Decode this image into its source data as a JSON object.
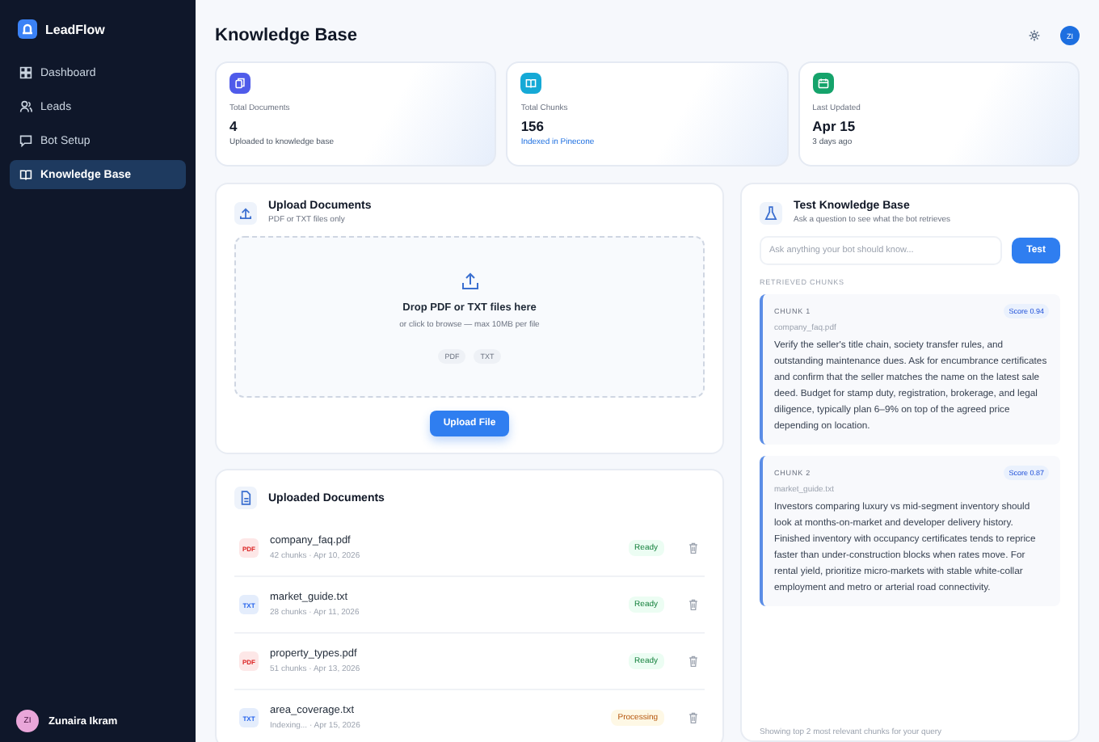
{
  "sidebar": {
    "brand": "LeadFlow",
    "items": [
      {
        "label": "Dashboard",
        "kind": "grid",
        "selected": false
      },
      {
        "label": "Leads",
        "kind": "users",
        "selected": false
      },
      {
        "label": "Bot Setup",
        "kind": "chat",
        "selected": false
      },
      {
        "label": "Knowledge Base",
        "kind": "book",
        "selected": true
      }
    ],
    "user": {
      "initials": "ZI",
      "name": "Zunaira Ikram"
    }
  },
  "header": {
    "title": "Knowledge Base",
    "avatar": "ZI"
  },
  "stats": [
    {
      "label": "Total Documents",
      "value": "4",
      "note": "Uploaded to knowledge base",
      "kind": "docs",
      "color": "#4f5bea",
      "highlight": false
    },
    {
      "label": "Total Chunks",
      "value": "156",
      "note": "Indexed in Pinecone",
      "kind": "book",
      "color": "#15a9d6",
      "highlight": true
    },
    {
      "label": "Last Updated",
      "value": "Apr 15",
      "note": "3 days ago",
      "kind": "calendar",
      "color": "#15a36b",
      "highlight": false
    }
  ],
  "upload": {
    "title": "Upload Documents",
    "subtitle": "PDF or TXT files only",
    "drop_title": "Drop PDF or TXT files here",
    "drop_hint": "or click to browse — max 10MB per file",
    "formats": [
      "PDF",
      "TXT"
    ],
    "button": "Upload File"
  },
  "documents": {
    "title": "Uploaded Documents",
    "items": [
      {
        "type": "PDF",
        "name": "company_faq.pdf",
        "meta": "42 chunks · Apr 10, 2026",
        "status": "Ready",
        "kind": "ready"
      },
      {
        "type": "TXT",
        "name": "market_guide.txt",
        "meta": "28 chunks · Apr 11, 2026",
        "status": "Ready",
        "kind": "ready"
      },
      {
        "type": "PDF",
        "name": "property_types.pdf",
        "meta": "51 chunks · Apr 13, 2026",
        "status": "Ready",
        "kind": "ready"
      },
      {
        "type": "TXT",
        "name": "area_coverage.txt",
        "meta": "Indexing... · Apr 15, 2026",
        "status": "Processing",
        "kind": "processing"
      }
    ]
  },
  "test": {
    "title": "Test Knowledge Base",
    "subtitle": "Ask a question to see what the bot retrieves",
    "placeholder": "Ask anything your bot should know...",
    "button": "Test",
    "section": "RETRIEVED CHUNKS",
    "chunks": [
      {
        "label": "CHUNK 1",
        "score": "Score 0.94",
        "source": "company_faq.pdf",
        "text": "Verify the seller's title chain, society transfer rules, and outstanding maintenance dues. Ask for encumbrance certificates and confirm that the seller matches the name on the latest sale deed. Budget for stamp duty, registration, brokerage, and legal diligence, typically plan 6–9% on top of the agreed price depending on location."
      },
      {
        "label": "CHUNK 2",
        "score": "Score 0.87",
        "source": "market_guide.txt",
        "text": "Investors comparing luxury vs mid-segment inventory should look at months-on-market and developer delivery history. Finished inventory with occupancy certificates tends to reprice faster than under-construction blocks when rates move. For rental yield, prioritize micro-markets with stable white-collar employment and metro or arterial road connectivity."
      }
    ],
    "footer": "Showing top 2 most relevant chunks for your query"
  }
}
